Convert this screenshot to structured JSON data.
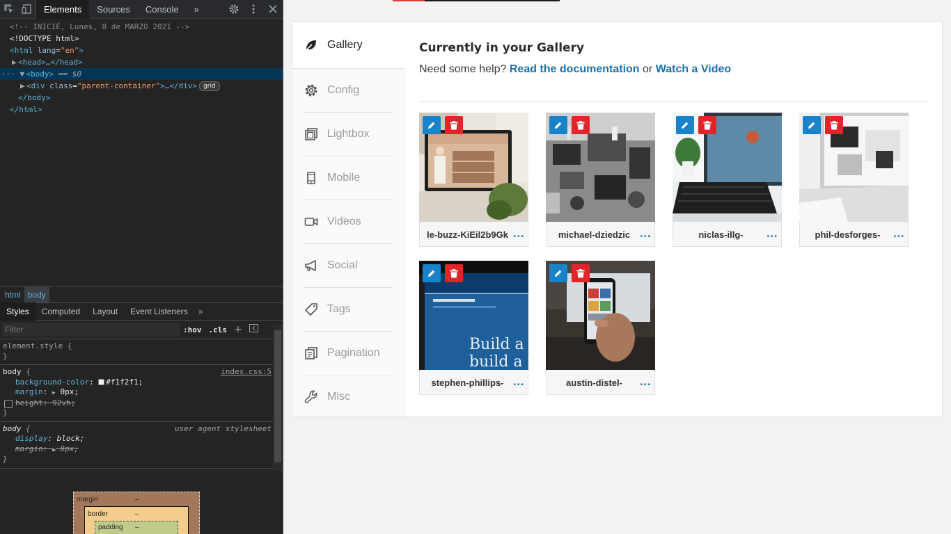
{
  "devtools": {
    "tabs": [
      "Elements",
      "Sources",
      "Console"
    ],
    "more_tabs": "»",
    "dom": {
      "comment": "<!-- INICIÉ, Lunes, 8 de MARZO 2021 -->",
      "doctype": "<!DOCTYPE html>",
      "html_open_tag": "<html",
      "html_attr": "lang",
      "html_val": "\"en\"",
      "html_close": ">",
      "head_line": "<head>…</head>",
      "body_open": "<body>",
      "body_marker": "== $0",
      "div_open": "<div",
      "div_attr": "class",
      "div_val": "\"parent-container\"",
      "div_close": ">…</div>",
      "grid_badge": "grid",
      "body_close": "</body>",
      "html_close_tag": "</html>"
    },
    "breadcrumbs": [
      "html",
      "body"
    ],
    "styles_tabs": [
      "Styles",
      "Computed",
      "Layout",
      "Event Listeners"
    ],
    "filter_placeholder": "Filter",
    "filter_hov": ":hov",
    "filter_cls": ".cls",
    "rules": {
      "element_style": "element.style {",
      "close": "}",
      "body_selector": "body",
      "open_brace": " {",
      "body_source": "index.css:5",
      "bg_name": "background-color",
      "bg_val": "#f1f2f1;",
      "margin_name": "margin",
      "margin_val": "0px;",
      "height_name": "height",
      "height_val": "92vh;",
      "ua_source": "user agent stylesheet",
      "display_name": "display",
      "display_val": "block;",
      "ua_margin_name": "margin",
      "ua_margin_val": "8px;"
    },
    "boxmodel": {
      "margin_label": "margin",
      "border_label": "border",
      "padding_label": "padding",
      "dash": "–"
    }
  },
  "sidebar": {
    "items": [
      {
        "label": "Gallery",
        "icon": "leaf-icon"
      },
      {
        "label": "Config",
        "icon": "gear-icon"
      },
      {
        "label": "Lightbox",
        "icon": "lightbox-icon"
      },
      {
        "label": "Mobile",
        "icon": "mobile-icon"
      },
      {
        "label": "Videos",
        "icon": "video-camera-icon"
      },
      {
        "label": "Social",
        "icon": "megaphone-icon"
      },
      {
        "label": "Tags",
        "icon": "tag-icon"
      },
      {
        "label": "Pagination",
        "icon": "pagination-icon"
      },
      {
        "label": "Misc",
        "icon": "wrench-icon"
      }
    ]
  },
  "main": {
    "title": "Currently in your Gallery",
    "help_prefix": "Need some help?",
    "help_link1": "Read the documentation",
    "help_or": "or",
    "help_link2": "Watch a Video",
    "images": [
      {
        "name": "le-buzz-KiEil2b9Gk"
      },
      {
        "name": "michael-dziedzic"
      },
      {
        "name": "niclas-illg-"
      },
      {
        "name": "phil-desforges-"
      },
      {
        "name": "stephen-phillips-"
      },
      {
        "name": "austin-distel-"
      }
    ],
    "more_label": "..."
  },
  "colors": {
    "accent_blue": "#1a72ad",
    "edit_blue": "#1a82c8",
    "delete_red": "#e0252b",
    "page_bg": "#f1f2f1"
  }
}
